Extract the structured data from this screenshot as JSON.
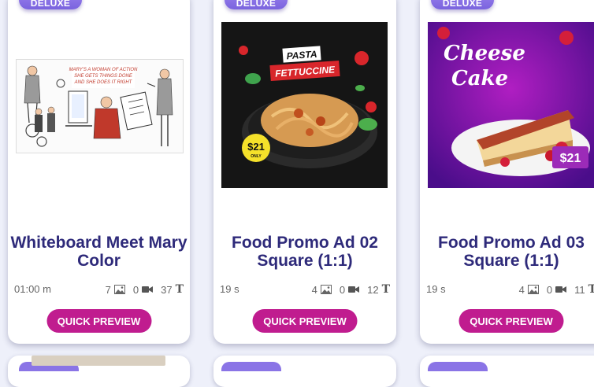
{
  "cards": [
    {
      "badge": "DELUXE",
      "title": "Whiteboard Meet Mary Color",
      "duration": "01:00 m",
      "images": "7",
      "videos": "0",
      "texts": "37",
      "button": "QUICK PREVIEW",
      "thumb": {
        "banner_line1": "MARY'S A WOMAN OF ACTION",
        "banner_line2": "SHE GETS THINGS DONE",
        "banner_line3": "AND SHE DOES IT RIGHT"
      }
    },
    {
      "badge": "DELUXE",
      "title": "Food Promo Ad 02 Square (1:1)",
      "duration": "19 s",
      "images": "4",
      "videos": "0",
      "texts": "12",
      "button": "QUICK PREVIEW",
      "thumb": {
        "label_top": "PASTA",
        "label_main": "FETTUCCINE",
        "price": "$21",
        "price_sub": "ONLY"
      }
    },
    {
      "badge": "DELUXE",
      "title": "Food Promo Ad 03 Square (1:1)",
      "duration": "19 s",
      "images": "4",
      "videos": "0",
      "texts": "11",
      "button": "QUICK PREVIEW",
      "thumb": {
        "line1": "Cheese",
        "line2": "Cake",
        "price": "$21"
      }
    }
  ],
  "colors": {
    "title": "#2e2a7a",
    "button": "#c01c8f",
    "badge": "#8a74e6",
    "background": "#eef0fa"
  },
  "icons": {
    "images": "image-icon",
    "videos": "video-camera-icon",
    "texts": "text-T-icon"
  }
}
